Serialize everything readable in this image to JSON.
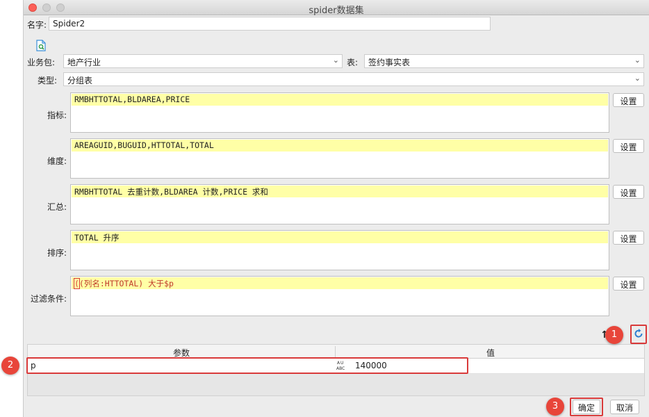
{
  "window": {
    "title": "spider数据集"
  },
  "name": {
    "label": "名字:",
    "value": "Spider2"
  },
  "preview_icon": "preview-doc-icon",
  "package": {
    "label": "业务包:",
    "value": "地产行业"
  },
  "table": {
    "label": "表:",
    "value": "签约事实表"
  },
  "type": {
    "label": "类型:",
    "value": "分组表"
  },
  "sections": {
    "metrics": {
      "label": "指标:",
      "value": "RMBHTTOTAL,BLDAREA,PRICE",
      "button": "设置"
    },
    "dimensions": {
      "label": "维度:",
      "value": "AREAGUID,BUGUID,HTTOTAL,TOTAL",
      "button": "设置"
    },
    "summary": {
      "label": "汇总:",
      "value": "RMBHTTOTAL 去重计数,BLDAREA 计数,PRICE 求和",
      "button": "设置"
    },
    "sort": {
      "label": "排序:",
      "value": "TOTAL 升序",
      "button": "设置"
    },
    "filter": {
      "label": "过滤条件:",
      "value_open": "(",
      "value": "(列名:HTTOTAL) 大于$p",
      "value_close": ")",
      "button": "设置"
    }
  },
  "params_table": {
    "columns": [
      "参数",
      "值"
    ],
    "rows": [
      {
        "param": "p",
        "type_icon": "abc",
        "value": "140000"
      }
    ]
  },
  "buttons": {
    "ok": "确定",
    "cancel": "取消"
  },
  "badges": [
    "1",
    "2",
    "3"
  ],
  "accent": "#e8453a"
}
